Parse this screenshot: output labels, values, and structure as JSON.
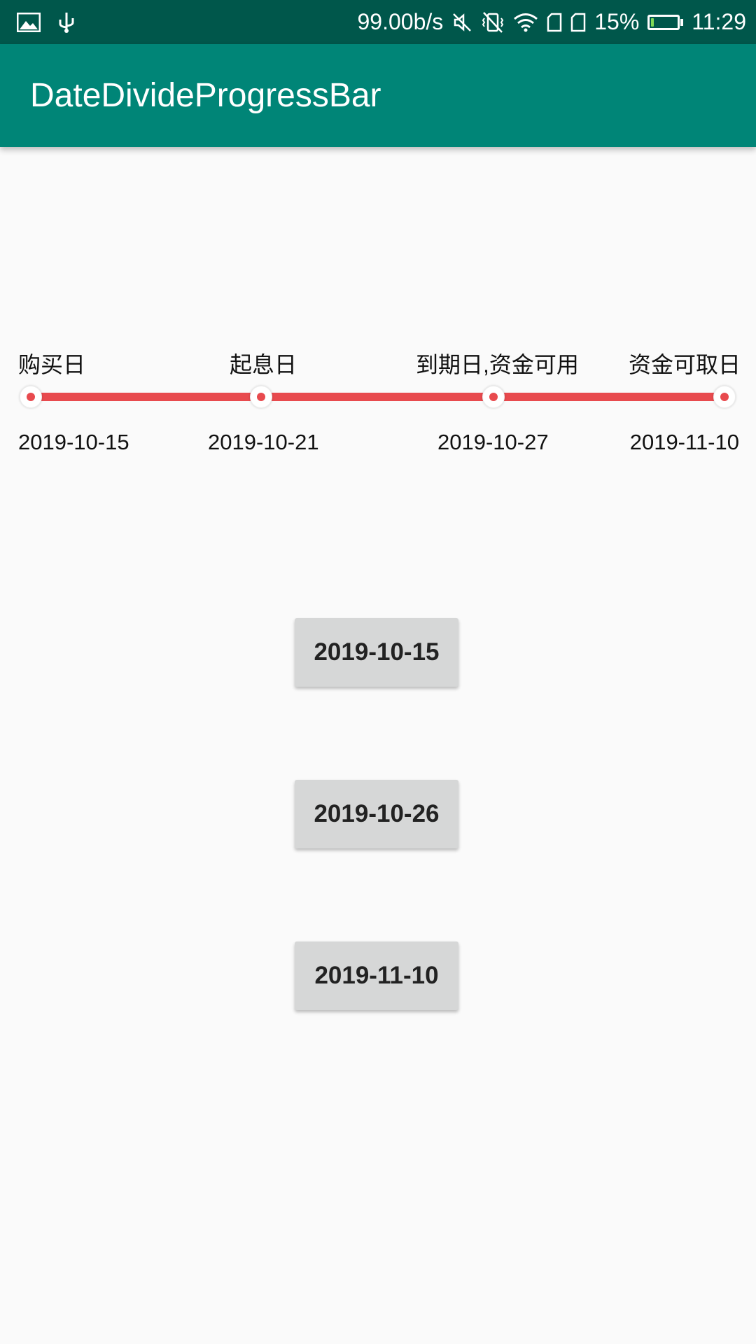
{
  "status_bar": {
    "left_icons": [
      "image-icon",
      "usb-icon"
    ],
    "network_speed": "99.00b/s",
    "right_icons": [
      "mute-icon",
      "vibrate-off-icon",
      "wifi-icon",
      "sim1-icon",
      "sim2-icon"
    ],
    "battery_percent": "15%",
    "battery_level": 0.15,
    "time": "11:29"
  },
  "app_bar": {
    "title": "DateDivideProgressBar",
    "color": "#008577",
    "status_color": "#00574b"
  },
  "progress": {
    "accent_color": "#e84a4e",
    "steps": [
      {
        "label": "购买日",
        "date": "2019-10-15"
      },
      {
        "label": "起息日",
        "date": "2019-10-21"
      },
      {
        "label": "到期日,资金可用",
        "date": "2019-10-27"
      },
      {
        "label": "资金可取日",
        "date": "2019-11-10"
      }
    ]
  },
  "buttons": [
    {
      "label": "2019-10-15"
    },
    {
      "label": "2019-10-26"
    },
    {
      "label": "2019-11-10"
    }
  ]
}
